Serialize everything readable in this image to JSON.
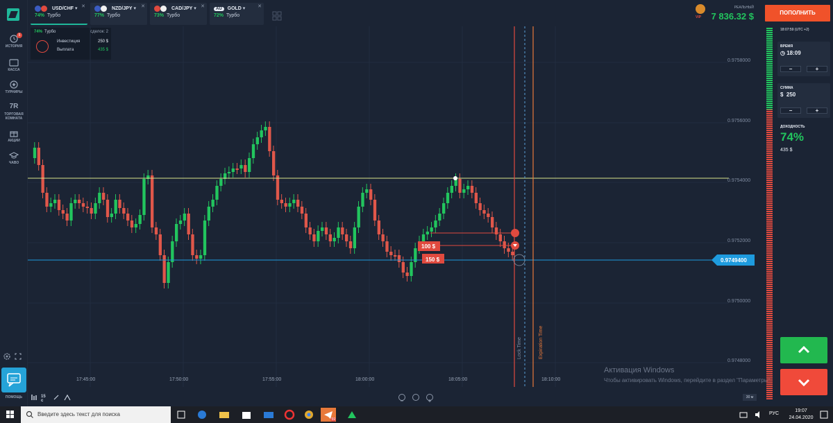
{
  "colors": {
    "accent_green": "#22c55e",
    "accent_red": "#f04a3a",
    "deposit_orange": "#f0522a",
    "bg": "#1b2434",
    "price_line_blue": "#1e9bde",
    "level_line_yellow": "#d9e38a",
    "teal_logo": "#1fb89b"
  },
  "sidebar": {
    "items": [
      {
        "label": "ИСТОРИЯ",
        "icon": "history-icon",
        "badge": "5"
      },
      {
        "label": "КАССА",
        "icon": "wallet-icon"
      },
      {
        "label": "ТУРНИРЫ",
        "icon": "tournament-icon"
      },
      {
        "label": "ТОРГОВАЯ КОМНАТА",
        "icon": "trading-room-icon",
        "glyph": "7R"
      },
      {
        "label": "АКЦИИ",
        "icon": "gift-icon"
      },
      {
        "label": "ЧАВО",
        "icon": "graduation-cap-icon"
      }
    ],
    "help_label": "ПОМОЩЬ"
  },
  "tabs": [
    {
      "pair": "USD/CHF",
      "pct": "74%",
      "mode": "Турбо",
      "active": true
    },
    {
      "pair": "NZD/JPY",
      "pct": "77%",
      "mode": "Турбо"
    },
    {
      "pair": "CAD/JPY",
      "pct": "73%",
      "mode": "Турбо"
    },
    {
      "pair": "GOLD",
      "prefix": "AU",
      "pct": "72%",
      "mode": "Турбо"
    }
  ],
  "trade_info": {
    "pct": "74%",
    "mode": "Турбо",
    "deals": "сделок: 2",
    "investment_label": "Инвестиция",
    "investment": "250 $",
    "payout_label": "Выплата",
    "payout": "435 $"
  },
  "header": {
    "vip": "VIP",
    "account": "РЕАЛЬНЫЙ",
    "balance": "7 836.32 $",
    "deposit": "ПОПОЛНИТЬ"
  },
  "chart": {
    "price_ticks": [
      "0.9758000",
      "0.9756000",
      "0.9754000",
      "0.9752000",
      "0.9750000",
      "0.9748000"
    ],
    "time_ticks": [
      "17:45:00",
      "17:50:00",
      "17:55:00",
      "18:00:00",
      "18:05:00",
      "18:10:00"
    ],
    "current_price": "0.9749400",
    "trade_labels": [
      "100 $",
      "150 $"
    ],
    "lock_time": "Lock Time",
    "expiration_time": "Expiration Time",
    "timeframe": "15 с",
    "zoom": "30 м"
  },
  "right_panel": {
    "server_time": "18:07:59 (UTC +2)",
    "time_label": "ВРЕМЯ",
    "time_value": "18:09",
    "amount_label": "СУММА",
    "amount_value": "250",
    "amount_currency": "$",
    "payout_label": "ДОХОДНОСТЬ",
    "payout_pct": "74%",
    "payout_amt": "435 $"
  },
  "watermark": {
    "line1": "Активация Windows",
    "line2": "Чтобы активировать Windows, перейдите в раздел \"Параметры\"."
  },
  "taskbar": {
    "search_placeholder": "Введите здесь текст для поиска",
    "lang": "РУС",
    "time": "19:07",
    "date": "24.04.2020",
    "badge": "59"
  }
}
